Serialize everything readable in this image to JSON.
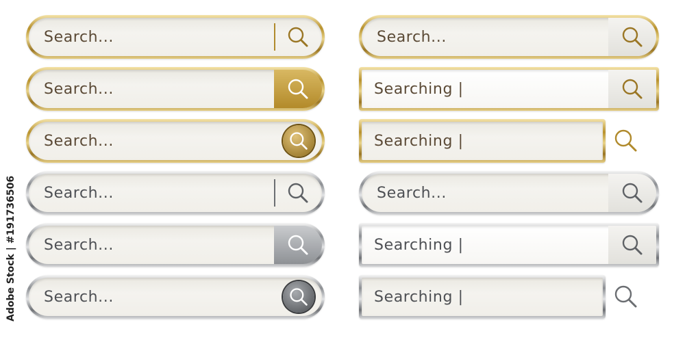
{
  "search_bars": {
    "gold_pill_divider": {
      "placeholder": "Search..."
    },
    "gold_pill_button": {
      "placeholder": "Search..."
    },
    "gold_pill_circle": {
      "placeholder": "Search..."
    },
    "silver_pill_divider": {
      "placeholder": "Search..."
    },
    "silver_pill_button": {
      "placeholder": "Search..."
    },
    "silver_pill_circle": {
      "placeholder": "Search..."
    },
    "gold_pill_box": {
      "placeholder": "Search..."
    },
    "gold_rect_box": {
      "value": "Searching |"
    },
    "gold_rect_outside": {
      "value": "Searching |"
    },
    "silver_pill_box": {
      "placeholder": "Search..."
    },
    "silver_rect_box": {
      "value": "Searching |"
    },
    "silver_rect_outside": {
      "value": "Searching |"
    }
  },
  "icons": {
    "search": "magnifying-glass-icon"
  },
  "colors": {
    "gold": "#b8922e",
    "silver": "#8c8f93",
    "field": "#f1efe9",
    "gold_text": "#5b4a36",
    "silver_text": "#4e5054"
  },
  "watermark": {
    "text": "Adobe Stock | #191736506"
  }
}
